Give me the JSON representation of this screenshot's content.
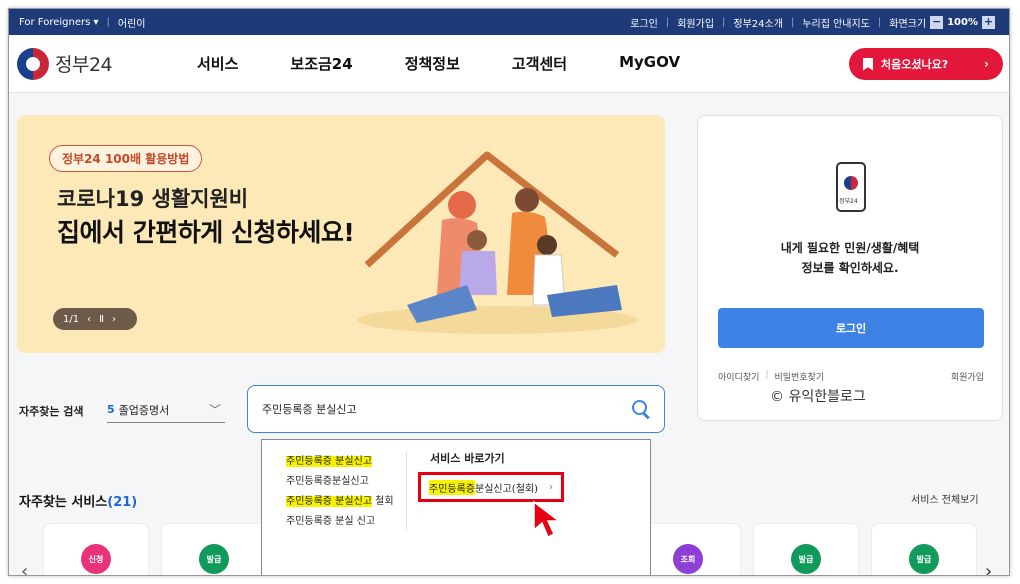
{
  "topbar": {
    "foreigners": "For Foreigners",
    "kids": "어린이",
    "login": "로그인",
    "signup": "회원가입",
    "about": "정부24소개",
    "nuri": "누리집 안내지도",
    "zoom_label": "화면크기",
    "zoom_minus": "−",
    "zoom_value": "100%",
    "zoom_plus": "+"
  },
  "nav": {
    "logo_text": "정부24",
    "menu": [
      "서비스",
      "보조금24",
      "정책정보",
      "고객센터",
      "MyGOV"
    ],
    "first_visit": "처음오셨나요?",
    "first_visit_arrow": "›"
  },
  "banner": {
    "tag": "정부24 100배 활용방법",
    "title1": "코로나19 생활지원비",
    "title2": "집에서 간편하게 신청하세요!",
    "pager": "1/1"
  },
  "login_card": {
    "phone_label": "정부24",
    "desc1": "내게 필요한 민원/생활/혜택",
    "desc2": "정보를 확인하세요.",
    "login_button": "로그인",
    "find_id": "아이디찾기",
    "find_pw": "비밀번호찾기",
    "join": "회원가입",
    "watermark": "© 유익한블로그"
  },
  "search": {
    "freq_label": "자주찾는 검색",
    "freq_num": "5",
    "freq_value": "졸업증명서",
    "query": "주민등록증 분실신고"
  },
  "dropdown": {
    "suggestions": [
      {
        "hl": "주민등록증 분실신고",
        "rest": ""
      },
      {
        "hl": "",
        "rest": "주민등록증분실신고"
      },
      {
        "hl": "주민등록증 분실신고",
        "rest": " 철회"
      },
      {
        "hl": "",
        "rest": "주민등록증 분실 신고"
      }
    ],
    "shortcut_title": "서비스 바로가기",
    "shortcut_hl": "주민등록증",
    "shortcut_rest": "분실신고(철회)",
    "shortcut_chevron": "›"
  },
  "services": {
    "title": "자주찾는 서비스",
    "count": "(21)",
    "all_link": "서비스 전체보기",
    "tiles": [
      {
        "badge": "신청",
        "color": "#e8337a"
      },
      {
        "badge": "발급",
        "color": "#119a5b"
      },
      {
        "badge": "조회",
        "color": "#8e3fd6"
      },
      {
        "badge": "발급",
        "color": "#119a5b"
      },
      {
        "badge": "발급",
        "color": "#119a5b"
      }
    ]
  },
  "colors": {
    "topbar": "#1e3a78",
    "accent": "#3f82e6",
    "highlight_box": "#e60012",
    "highlight_text": "#f7f200"
  }
}
